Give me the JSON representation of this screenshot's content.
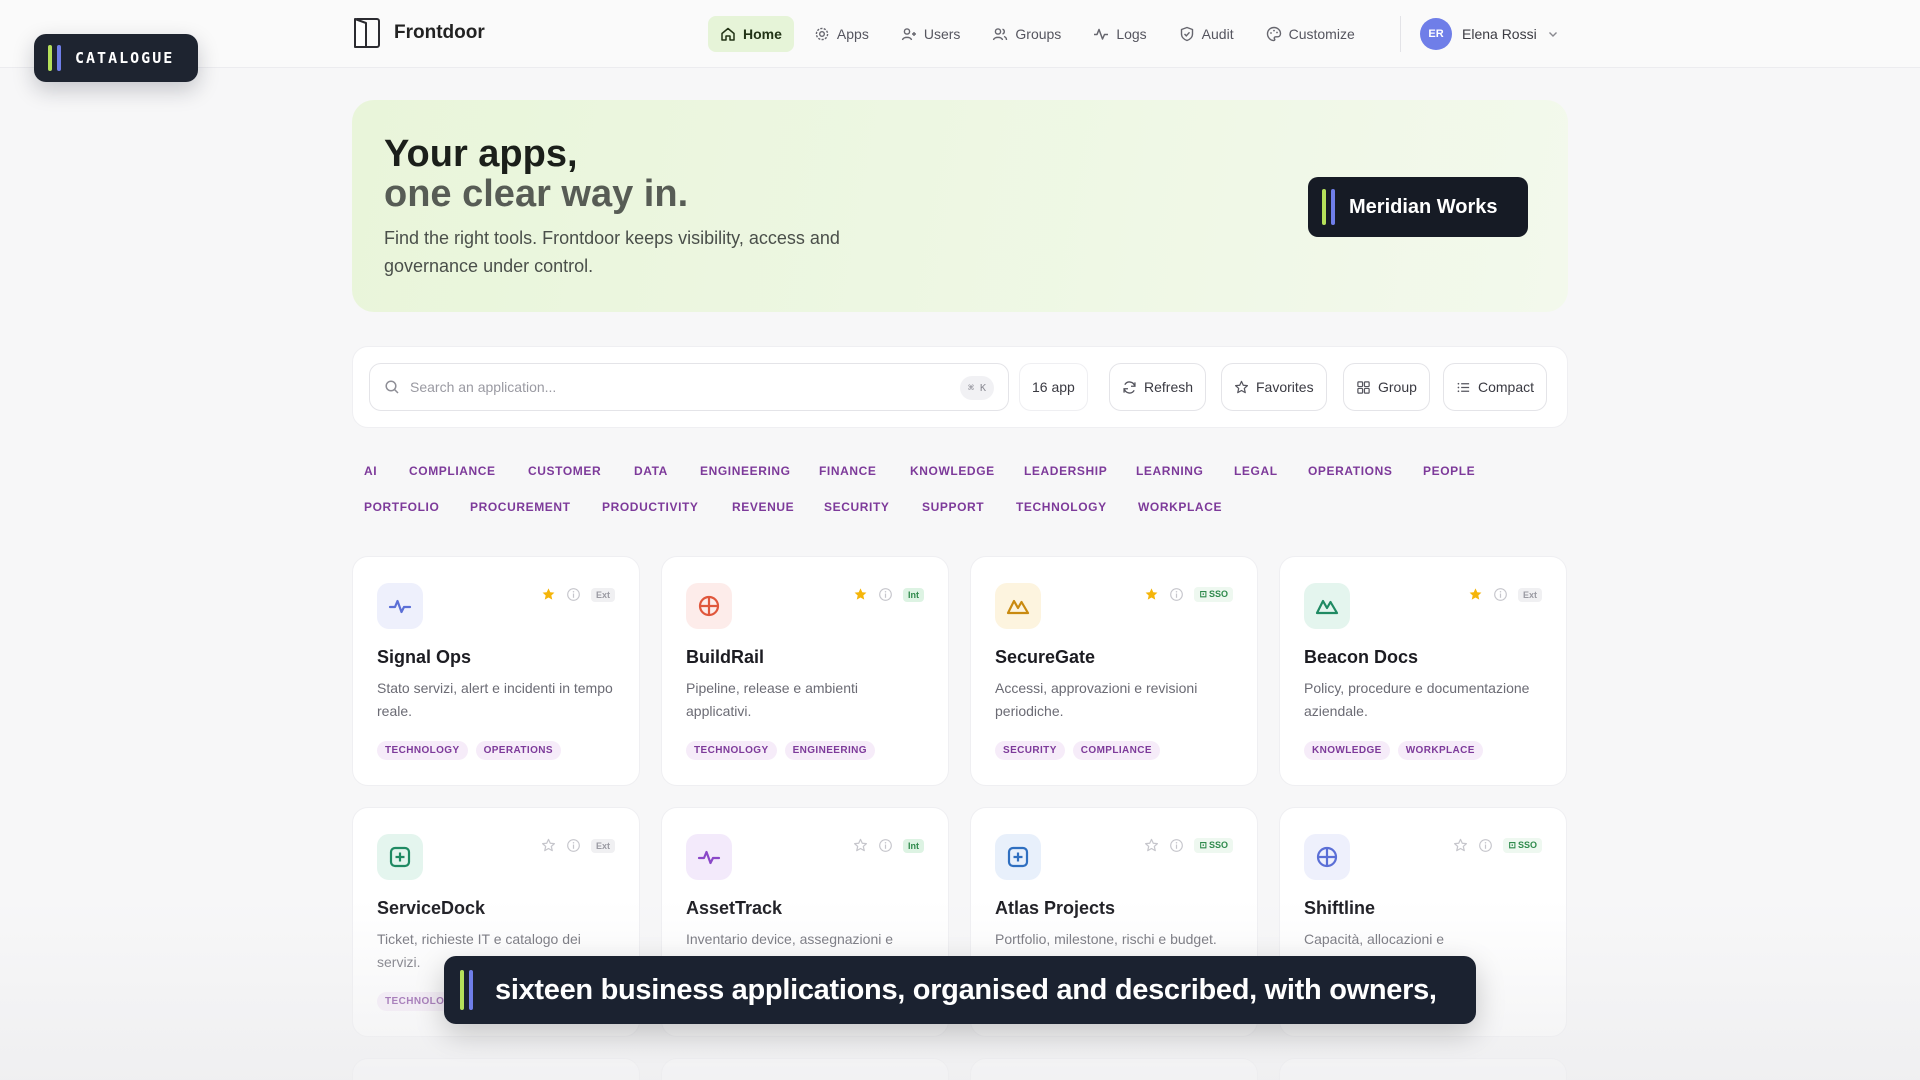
{
  "app": {
    "name": "Frontdoor"
  },
  "catalogue_badge": {
    "label": "CATALOGUE"
  },
  "nav": {
    "items": [
      {
        "label": "Home",
        "icon": "home-icon",
        "active": true
      },
      {
        "label": "Apps",
        "icon": "gear-icon"
      },
      {
        "label": "Users",
        "icon": "users-icon"
      },
      {
        "label": "Groups",
        "icon": "groups-icon"
      },
      {
        "label": "Logs",
        "icon": "activity-icon"
      },
      {
        "label": "Audit",
        "icon": "shield-icon"
      },
      {
        "label": "Customize",
        "icon": "palette-icon"
      }
    ]
  },
  "user": {
    "initials": "ER",
    "name": "Elena Rossi"
  },
  "hero": {
    "title_line1": "Your apps,",
    "title_line2": "one clear way in.",
    "subtitle": "Find the right tools. Frontdoor keeps visibility, access and governance under control.",
    "org_name": "Meridian Works"
  },
  "toolbar": {
    "search_placeholder": "Search an application...",
    "shortcut": "⌘ K",
    "count": "16 app",
    "refresh": "Refresh",
    "favorites": "Favorites",
    "group": "Group",
    "compact": "Compact"
  },
  "filters": [
    "AI",
    "COMPLIANCE",
    "CUSTOMER",
    "DATA",
    "ENGINEERING",
    "FINANCE",
    "KNOWLEDGE",
    "LEADERSHIP",
    "LEARNING",
    "LEGAL",
    "OPERATIONS",
    "PEOPLE",
    "PORTFOLIO",
    "PROCUREMENT",
    "PRODUCTIVITY",
    "REVENUE",
    "SECURITY",
    "SUPPORT",
    "TECHNOLOGY",
    "WORKPLACE"
  ],
  "apps": [
    {
      "name": "Signal Ops",
      "desc": "Stato servizi, alert e incidenti in tempo reale.",
      "tags": [
        "TECHNOLOGY",
        "OPERATIONS"
      ],
      "badge": "Ext",
      "favorite": true,
      "icon": "pulse-icon",
      "color": "#5b6fd6",
      "bg": "#eef0fc"
    },
    {
      "name": "BuildRail",
      "desc": "Pipeline, release e ambienti applicativi.",
      "tags": [
        "TECHNOLOGY",
        "ENGINEERING"
      ],
      "badge": "Int",
      "favorite": true,
      "icon": "target-icon",
      "color": "#e0573c",
      "bg": "#fdecea"
    },
    {
      "name": "SecureGate",
      "desc": "Accessi, approvazioni e revisioni periodiche.",
      "tags": [
        "SECURITY",
        "COMPLIANCE"
      ],
      "badge": "SSO",
      "favorite": true,
      "icon": "mountain-icon",
      "color": "#c98a10",
      "bg": "#fdf4df"
    },
    {
      "name": "Beacon Docs",
      "desc": "Policy, procedure e documentazione aziendale.",
      "tags": [
        "KNOWLEDGE",
        "WORKPLACE"
      ],
      "badge": "Ext",
      "favorite": true,
      "icon": "mountain-icon",
      "color": "#1f8a63",
      "bg": "#e4f5ee"
    },
    {
      "name": "ServiceDock",
      "desc": "Ticket, richieste IT e catalogo dei servizi.",
      "tags": [
        "TECHNOLOGY"
      ],
      "badge": "Ext",
      "favorite": false,
      "icon": "plus-square-icon",
      "color": "#1f8a63",
      "bg": "#e4f5ee"
    },
    {
      "name": "AssetTrack",
      "desc": "Inventario device, assegnazioni e",
      "tags": [],
      "badge": "Int",
      "favorite": false,
      "icon": "pulse-icon",
      "color": "#8a47c8",
      "bg": "#f3eafb"
    },
    {
      "name": "Atlas Projects",
      "desc": "Portfolio, milestone, rischi e budget.",
      "tags": [],
      "badge": "SSO",
      "favorite": false,
      "icon": "plus-square-icon",
      "color": "#2f6fc0",
      "bg": "#e8f0fb"
    },
    {
      "name": "Shiftline",
      "desc": "Capacità, allocazioni e",
      "tags": [],
      "badge": "SSO",
      "favorite": false,
      "icon": "target-icon",
      "color": "#5b6fd6",
      "bg": "#eef0fc"
    }
  ],
  "caption": {
    "text": "sixteen business applications, organised and described, with owners,"
  },
  "colors": {
    "accent_green": "#b5e05a",
    "accent_blue": "#6f7ee8",
    "tag_purple": "#7d3a9a",
    "star": "#f5b50a"
  }
}
